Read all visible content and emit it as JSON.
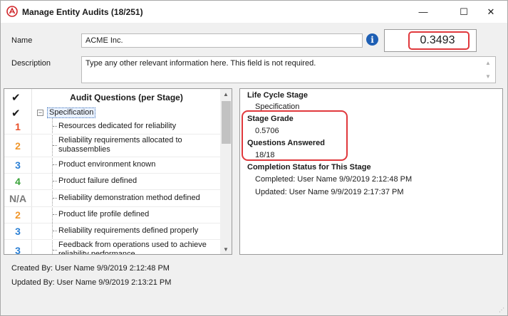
{
  "window": {
    "title": "Manage Entity Audits (18/251)",
    "min_glyph": "—",
    "max_glyph": "☐",
    "close_glyph": "✕"
  },
  "form": {
    "name_label": "Name",
    "name_value": "ACME Inc.",
    "info_glyph": "i",
    "score": "0.3493",
    "description_label": "Description",
    "description_value": "Type any other relevant information here. This field is not required."
  },
  "audit_questions": {
    "header_check": "✔",
    "header_title": "Audit Questions (per Stage)",
    "stage_check": "✔",
    "stage_name": "Specification",
    "expander_glyph": "−",
    "rows": [
      {
        "grade": "1",
        "grade_color": "#e8502a",
        "text": "Resources dedicated for reliability"
      },
      {
        "grade": "2",
        "grade_color": "#f0962a",
        "text": "Reliability requirements allocated to subassemblies"
      },
      {
        "grade": "3",
        "grade_color": "#2a7fd4",
        "text": "Product environment known"
      },
      {
        "grade": "4",
        "grade_color": "#3aa33a",
        "text": "Product failure defined"
      },
      {
        "grade": "N/A",
        "grade_color": "#7a7a7a",
        "text": "Reliability demonstration method defined"
      },
      {
        "grade": "2",
        "grade_color": "#f0962a",
        "text": "Product life profile defined"
      },
      {
        "grade": "3",
        "grade_color": "#2a7fd4",
        "text": "Reliability requirements defined properly"
      },
      {
        "grade": "3",
        "grade_color": "#2a7fd4",
        "text": "Feedback from operations used to achieve reliability performance"
      }
    ]
  },
  "details": {
    "life_cycle_label": "Life Cycle Stage",
    "life_cycle_value": "Specification",
    "stage_grade_label": "Stage Grade",
    "stage_grade_value": "0.5706",
    "questions_answered_label": "Questions Answered",
    "questions_answered_value": "18/18",
    "completion_label": "Completion Status for This Stage",
    "completed_value": "Completed: User Name 9/9/2019 2:12:48 PM",
    "updated_value": "Updated: User Name 9/9/2019 2:17:37 PM"
  },
  "footer": {
    "created_by": "Created By: User Name 9/9/2019 2:12:48 PM",
    "updated_by": "Updated By: User Name 9/9/2019 2:13:21 PM"
  },
  "colors": {
    "highlight": "#e0383c",
    "info_blue": "#1e5fb4"
  }
}
